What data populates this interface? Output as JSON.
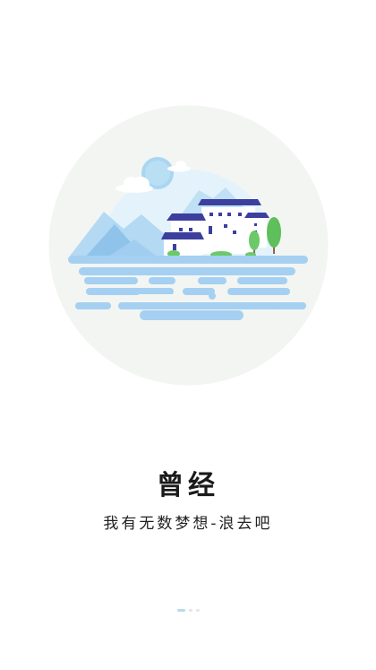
{
  "splash": {
    "title": "曾经",
    "subtitle": "我有无数梦想-浪去吧"
  },
  "illustration": {
    "subject": "village-by-lake-illustration",
    "colors": {
      "circle": "#f3f5f2",
      "sky": "#e4f3fb",
      "sun": "#a9d6f2",
      "mountain": "#a6d1f0",
      "water": "#a5d0f2",
      "roof": "#3c3f9e",
      "wall": "#ffffff",
      "tree": "#5ebf5b",
      "trunk": "#8a6a4a"
    }
  },
  "pager": {
    "pages": 3,
    "active_index": 0,
    "colors": {
      "active": "#b9dbe8",
      "inactive": "#e2e6ea"
    }
  }
}
